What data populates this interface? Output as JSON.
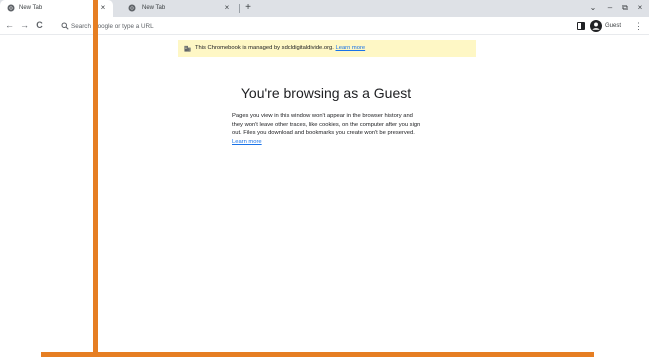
{
  "tabs": [
    {
      "title": "New Tab",
      "active": true
    },
    {
      "title": "New Tab",
      "active": false
    }
  ],
  "tab_close_glyph": "×",
  "new_tab_glyph": "+",
  "window_controls": {
    "dropdown": "⌄",
    "minimize": "–",
    "restore": "⧉",
    "close": "×"
  },
  "toolbar": {
    "back_glyph": "←",
    "forward_glyph": "→",
    "reload_glyph": "C",
    "menu_glyph": "⋮"
  },
  "omnibox": {
    "value": "",
    "placeholder": "Search Google or type a URL"
  },
  "profile": {
    "label": "Guest"
  },
  "banner": {
    "text": "This Chromebook is managed by sdcldigitaldivide.org.",
    "link": "Learn more"
  },
  "guest": {
    "heading": "You're browsing as a Guest",
    "body": "Pages you view in this window won't appear in the browser history and they won't leave other traces, like cookies, on the computer after you sign out. Files you download and bookmarks you create won't be preserved.",
    "link": "Learn more"
  },
  "colors": {
    "tabstrip": "#dee1e6",
    "banner": "#fef7c5",
    "link": "#1a73e8",
    "annotation": "#e67e22"
  }
}
